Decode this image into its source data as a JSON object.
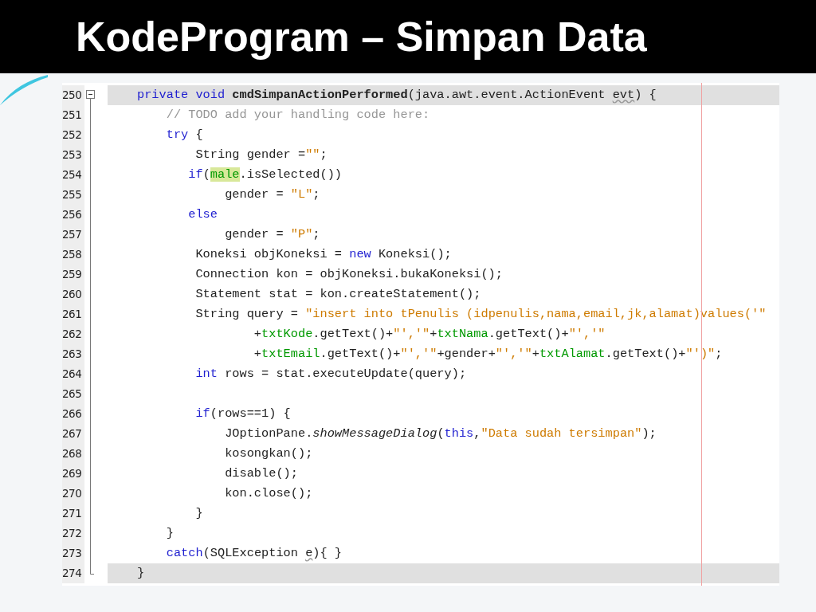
{
  "slide": {
    "title": "KodeProgram – Simpan Data"
  },
  "editor": {
    "lines": [
      {
        "number": "250",
        "current": true,
        "kind": "start",
        "tokens": [
          {
            "kind": "kw",
            "t": "private void "
          },
          {
            "kind": "bold",
            "t": "cmdSimpanActionPerformed"
          },
          {
            "kind": "plain",
            "t": "(java.awt.event.ActionEvent "
          },
          {
            "kind": "squiggle",
            "t": "evt"
          },
          {
            "kind": "plain",
            "t": ") {"
          }
        ]
      },
      {
        "number": "251",
        "current": false,
        "kind": "body",
        "tokens": [
          {
            "kind": "comment",
            "t": "    // TODO add your handling code here:"
          }
        ]
      },
      {
        "number": "252",
        "current": false,
        "kind": "body",
        "tokens": [
          {
            "kind": "kw",
            "t": "    try"
          },
          {
            "kind": "plain",
            "t": " {"
          }
        ]
      },
      {
        "number": "253",
        "current": false,
        "kind": "body",
        "tokens": [
          {
            "kind": "plain",
            "t": "        String gender ="
          },
          {
            "kind": "str",
            "t": "\"\""
          },
          {
            "kind": "plain",
            "t": ";"
          }
        ]
      },
      {
        "number": "254",
        "current": false,
        "kind": "body",
        "tokens": [
          {
            "kind": "kw",
            "t": "       if"
          },
          {
            "kind": "plain",
            "t": "("
          },
          {
            "kind": "mark",
            "t": "male"
          },
          {
            "kind": "plain",
            "t": ".isSelected())"
          }
        ]
      },
      {
        "number": "255",
        "current": false,
        "kind": "body",
        "tokens": [
          {
            "kind": "plain",
            "t": "            gender = "
          },
          {
            "kind": "str",
            "t": "\"L\""
          },
          {
            "kind": "plain",
            "t": ";"
          }
        ]
      },
      {
        "number": "256",
        "current": false,
        "kind": "body",
        "tokens": [
          {
            "kind": "kw",
            "t": "       else"
          }
        ]
      },
      {
        "number": "257",
        "current": false,
        "kind": "body",
        "tokens": [
          {
            "kind": "plain",
            "t": "            gender = "
          },
          {
            "kind": "str",
            "t": "\"P\""
          },
          {
            "kind": "plain",
            "t": ";"
          }
        ]
      },
      {
        "number": "258",
        "current": false,
        "kind": "body",
        "tokens": [
          {
            "kind": "plain",
            "t": "        Koneksi objKoneksi = "
          },
          {
            "kind": "kw",
            "t": "new"
          },
          {
            "kind": "plain",
            "t": " Koneksi();"
          }
        ]
      },
      {
        "number": "259",
        "current": false,
        "kind": "body",
        "tokens": [
          {
            "kind": "plain",
            "t": "        Connection kon = objKoneksi.bukaKoneksi();"
          }
        ]
      },
      {
        "number": "260",
        "current": false,
        "kind": "body",
        "tokens": [
          {
            "kind": "plain",
            "t": "        Statement stat = kon.createStatement();"
          }
        ]
      },
      {
        "number": "261",
        "current": false,
        "kind": "body",
        "tokens": [
          {
            "kind": "plain",
            "t": "        String query = "
          },
          {
            "kind": "str",
            "t": "\"insert into tPenulis (idpenulis,nama,email,jk,alamat)values('\""
          }
        ]
      },
      {
        "number": "262",
        "current": false,
        "kind": "body",
        "tokens": [
          {
            "kind": "plain",
            "t": "                +"
          },
          {
            "kind": "field",
            "t": "txtKode"
          },
          {
            "kind": "plain",
            "t": ".getText()+"
          },
          {
            "kind": "str",
            "t": "\"','\""
          },
          {
            "kind": "plain",
            "t": "+"
          },
          {
            "kind": "field",
            "t": "txtNama"
          },
          {
            "kind": "plain",
            "t": ".getText()+"
          },
          {
            "kind": "str",
            "t": "\"','\""
          }
        ]
      },
      {
        "number": "263",
        "current": false,
        "kind": "body",
        "tokens": [
          {
            "kind": "plain",
            "t": "                +"
          },
          {
            "kind": "field",
            "t": "txtEmail"
          },
          {
            "kind": "plain",
            "t": ".getText()+"
          },
          {
            "kind": "str",
            "t": "\"','\""
          },
          {
            "kind": "plain",
            "t": "+gender+"
          },
          {
            "kind": "str",
            "t": "\"','\""
          },
          {
            "kind": "plain",
            "t": "+"
          },
          {
            "kind": "field",
            "t": "txtAlamat"
          },
          {
            "kind": "plain",
            "t": ".getText()+"
          },
          {
            "kind": "str",
            "t": "\"')\""
          },
          {
            "kind": "plain",
            "t": ";"
          }
        ]
      },
      {
        "number": "264",
        "current": false,
        "kind": "body",
        "tokens": [
          {
            "kind": "kw",
            "t": "        int"
          },
          {
            "kind": "plain",
            "t": " rows = stat.executeUpdate(query);"
          }
        ]
      },
      {
        "number": "265",
        "current": false,
        "kind": "body"
      },
      {
        "number": "266",
        "current": false,
        "kind": "body",
        "tokens": [
          {
            "kind": "kw",
            "t": "        if"
          },
          {
            "kind": "plain",
            "t": "(rows==1) {"
          }
        ]
      },
      {
        "number": "267",
        "current": false,
        "kind": "body",
        "tokens": [
          {
            "kind": "plain",
            "t": "            JOptionPane."
          },
          {
            "kind": "italic",
            "t": "showMessageDialog"
          },
          {
            "kind": "plain",
            "t": "("
          },
          {
            "kind": "kw",
            "t": "this"
          },
          {
            "kind": "plain",
            "t": ","
          },
          {
            "kind": "str",
            "t": "\"Data sudah tersimpan\""
          },
          {
            "kind": "plain",
            "t": ");"
          }
        ]
      },
      {
        "number": "268",
        "current": false,
        "kind": "body",
        "tokens": [
          {
            "kind": "plain",
            "t": "            kosongkan();"
          }
        ]
      },
      {
        "number": "269",
        "current": false,
        "kind": "body",
        "tokens": [
          {
            "kind": "plain",
            "t": "            disable();"
          }
        ]
      },
      {
        "number": "270",
        "current": false,
        "kind": "body",
        "tokens": [
          {
            "kind": "plain",
            "t": "            kon.close();"
          }
        ]
      },
      {
        "number": "271",
        "current": false,
        "kind": "body",
        "tokens": [
          {
            "kind": "plain",
            "t": "        }"
          }
        ]
      },
      {
        "number": "272",
        "current": false,
        "kind": "body",
        "tokens": [
          {
            "kind": "plain",
            "t": "    }"
          }
        ]
      },
      {
        "number": "273",
        "current": false,
        "kind": "body",
        "tokens": [
          {
            "kind": "kw",
            "t": "    catch"
          },
          {
            "kind": "plain",
            "t": "(SQLException "
          },
          {
            "kind": "squiggle",
            "t": "e"
          },
          {
            "kind": "plain",
            "t": "){ }"
          }
        ]
      },
      {
        "number": "274",
        "current": true,
        "kind": "end",
        "tokens": [
          {
            "kind": "plain",
            "t": "}"
          }
        ]
      }
    ]
  }
}
